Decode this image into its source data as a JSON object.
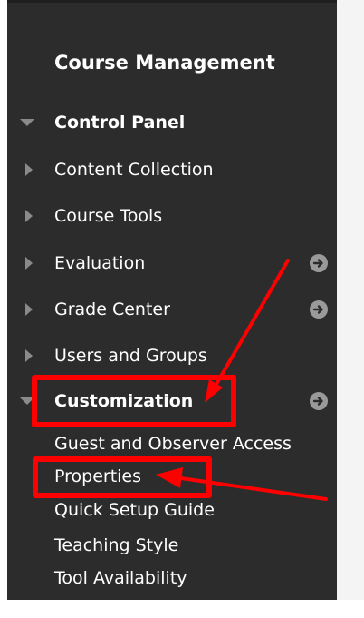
{
  "panel": {
    "title": "Course Management",
    "items": [
      {
        "label": "Control Panel",
        "bold": true,
        "expanded": true,
        "has_go": false
      },
      {
        "label": "Content Collection",
        "bold": false,
        "expanded": false,
        "has_go": false
      },
      {
        "label": "Course Tools",
        "bold": false,
        "expanded": false,
        "has_go": false
      },
      {
        "label": "Evaluation",
        "bold": false,
        "expanded": false,
        "has_go": true
      },
      {
        "label": "Grade Center",
        "bold": false,
        "expanded": false,
        "has_go": true
      },
      {
        "label": "Users and Groups",
        "bold": false,
        "expanded": false,
        "has_go": false
      },
      {
        "label": "Customization",
        "bold": true,
        "expanded": true,
        "has_go": true
      }
    ],
    "customization_subitems": [
      "Guest and Observer Access",
      "Properties",
      "Quick Setup Guide",
      "Teaching Style",
      "Tool Availability"
    ]
  },
  "icons": {
    "collapsed": "triangle-right-icon",
    "expanded": "triangle-down-icon",
    "go": "circle-arrow-right-icon"
  },
  "colors": {
    "panel_bg": "#2c2c2c",
    "text": "#ffffff",
    "icon_gray": "#8a8a8a",
    "annotation_red": "#ff0000"
  }
}
